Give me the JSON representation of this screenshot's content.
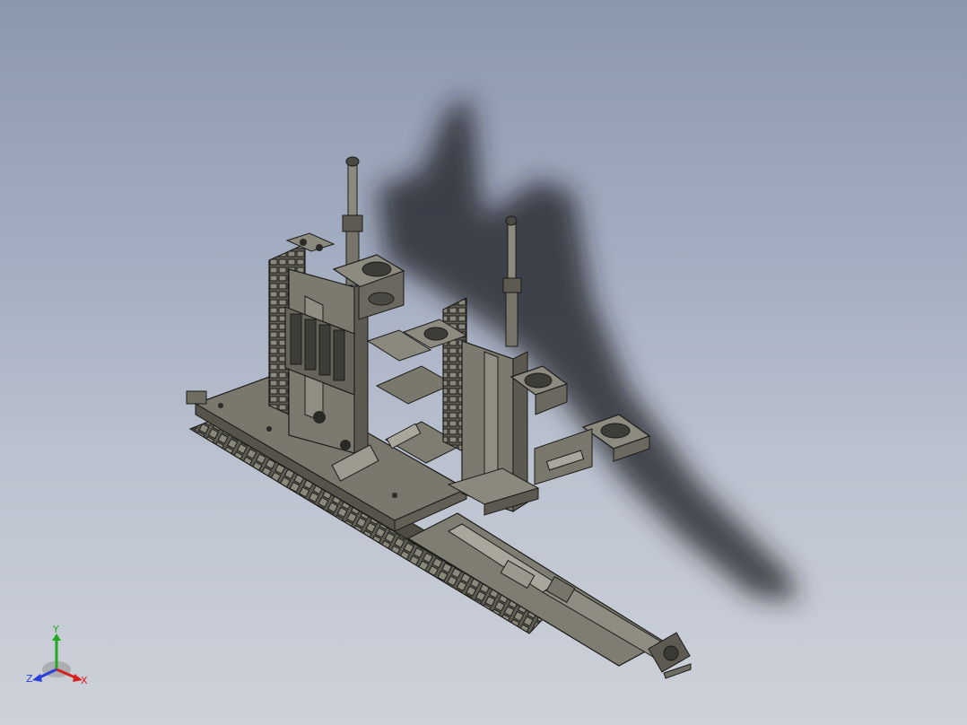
{
  "viewport": {
    "background_top": "#8b97ad",
    "background_bottom": "#cdd1d9",
    "model_color": "#6f6d62",
    "model_edge_color": "#1c1c1a",
    "shadow_color": "#1e1f22"
  },
  "triad": {
    "y_label": "Y",
    "z_label": "Z",
    "x_label": "X",
    "x_color": "#d82020",
    "y_color": "#1faa1f",
    "z_color": "#2b3fd8"
  }
}
